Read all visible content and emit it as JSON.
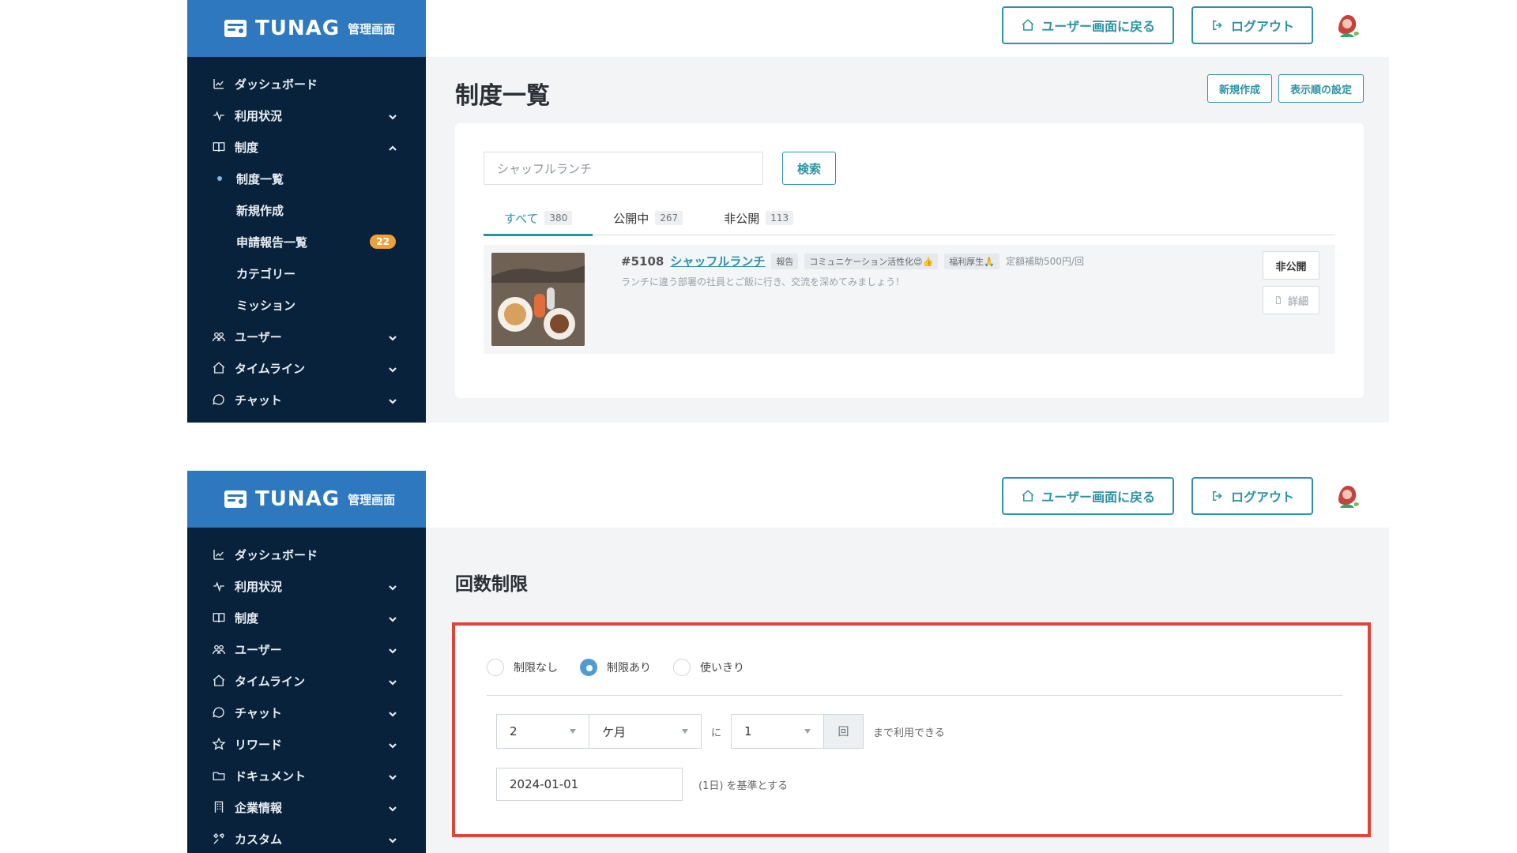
{
  "app": {
    "brand": "TUNAG",
    "brand_sub": "管理画面"
  },
  "header": {
    "back_to_user": "ユーザー画面に戻る",
    "logout": "ログアウト"
  },
  "top": {
    "sidebar": {
      "items": [
        {
          "label": "ダッシュボード",
          "icon": "chart-icon",
          "chev": ""
        },
        {
          "label": "利用状況",
          "icon": "pulse-icon",
          "chev": "down"
        },
        {
          "label": "制度",
          "icon": "book-icon",
          "chev": "up"
        }
      ],
      "sub_items": [
        {
          "label": "制度一覧",
          "active": true
        },
        {
          "label": "新規作成",
          "active": false
        },
        {
          "label": "申請報告一覧",
          "active": false,
          "badge": "22"
        },
        {
          "label": "カテゴリー",
          "active": false
        },
        {
          "label": "ミッション",
          "active": false
        }
      ],
      "items_after": [
        {
          "label": "ユーザー",
          "icon": "users-icon",
          "chev": "down"
        },
        {
          "label": "タイムライン",
          "icon": "home-icon",
          "chev": "down"
        },
        {
          "label": "チャット",
          "icon": "chat-icon",
          "chev": "down"
        }
      ]
    },
    "page_title": "制度一覧",
    "actions": {
      "new": "新規作成",
      "order": "表示順の設定"
    },
    "search": {
      "value": "シャッフルランチ",
      "button": "検索"
    },
    "tabs": [
      {
        "label": "すべて",
        "count": "380",
        "active": true
      },
      {
        "label": "公開中",
        "count": "267",
        "active": false
      },
      {
        "label": "非公開",
        "count": "113",
        "active": false
      }
    ],
    "item": {
      "id": "#5108",
      "name": "シャッフルランチ",
      "tags": [
        "報告",
        "コミュニケーション活性化😍👍",
        "福利厚生🙏"
      ],
      "meta": "定額補助500円/回",
      "desc": "ランチに違う部署の社員とご飯に行き、交流を深めてみましょう！",
      "btn_private": "非公開",
      "btn_detail": "詳細"
    }
  },
  "bottom": {
    "sidebar": {
      "items": [
        {
          "label": "ダッシュボード",
          "icon": "chart-icon",
          "chev": ""
        },
        {
          "label": "利用状況",
          "icon": "pulse-icon",
          "chev": "down"
        },
        {
          "label": "制度",
          "icon": "book-icon",
          "chev": "down"
        },
        {
          "label": "ユーザー",
          "icon": "users-icon",
          "chev": "down"
        },
        {
          "label": "タイムライン",
          "icon": "home-icon",
          "chev": "down"
        },
        {
          "label": "チャット",
          "icon": "chat-icon",
          "chev": "down"
        },
        {
          "label": "リワード",
          "icon": "star-icon",
          "chev": "down"
        },
        {
          "label": "ドキュメント",
          "icon": "folder-icon",
          "chev": "down"
        },
        {
          "label": "企業情報",
          "icon": "building-icon",
          "chev": "down"
        },
        {
          "label": "カスタム",
          "icon": "tools-icon",
          "chev": "down"
        }
      ]
    },
    "section_title": "回数制限",
    "radios": [
      {
        "label": "制限なし",
        "selected": false
      },
      {
        "label": "制限あり",
        "selected": true
      },
      {
        "label": "使いきり",
        "selected": false
      }
    ],
    "limit": {
      "period_value": "2",
      "period_unit": "ケ月",
      "mid_text": "に",
      "count_value": "1",
      "count_unit": "回",
      "tail_text": "まで利用できる"
    },
    "date": {
      "value": "2024-01-01",
      "hint": "(1日) を基準とする"
    }
  },
  "colors": {
    "brand_blue": "#2d78bf",
    "sidebar_navy": "#07223a",
    "teal": "#2a93a3",
    "highlight_red": "#e04437",
    "badge_orange": "#f0a03b"
  }
}
